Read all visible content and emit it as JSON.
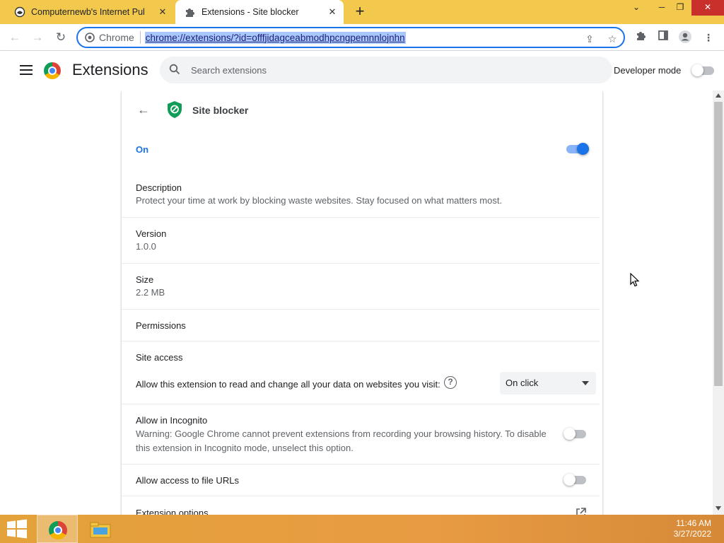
{
  "browser": {
    "tabs": [
      {
        "title": "Computernewb's Internet Pub Hu",
        "icon": "pub-favicon-icon",
        "active": false
      },
      {
        "title": "Extensions - Site blocker",
        "icon": "puzzle-icon",
        "active": true
      }
    ],
    "omnibox": {
      "scheme_label": "Chrome",
      "url": "chrome://extensions/?id=offfjidagceabmodhpcngpemnnlojnhn"
    }
  },
  "header": {
    "title": "Extensions",
    "search_placeholder": "Search extensions",
    "developer_mode_label": "Developer mode",
    "developer_mode_on": false
  },
  "extension": {
    "name": "Site blocker",
    "enabled_label": "On",
    "enabled": true,
    "description_label": "Description",
    "description": "Protect your time at work by blocking waste websites. Stay focused on what matters most.",
    "version_label": "Version",
    "version": "1.0.0",
    "size_label": "Size",
    "size": "2.2 MB",
    "permissions_label": "Permissions",
    "site_access_label": "Site access",
    "site_access_prompt": "Allow this extension to read and change all your data on websites you visit:",
    "site_access_value": "On click",
    "incognito_label": "Allow in Incognito",
    "incognito_warning": "Warning: Google Chrome cannot prevent extensions from recording your browsing history. To disable this extension in Incognito mode, unselect this option.",
    "incognito_on": false,
    "file_urls_label": "Allow access to file URLs",
    "file_urls_on": false,
    "options_label": "Extension options"
  },
  "taskbar": {
    "time": "11:46 AM",
    "date": "3/27/2022"
  },
  "colors": {
    "accent": "#1a73e8",
    "tabbar": "#f2c94c",
    "taskbar": "#e89b42",
    "shield": "#0f9d58"
  }
}
